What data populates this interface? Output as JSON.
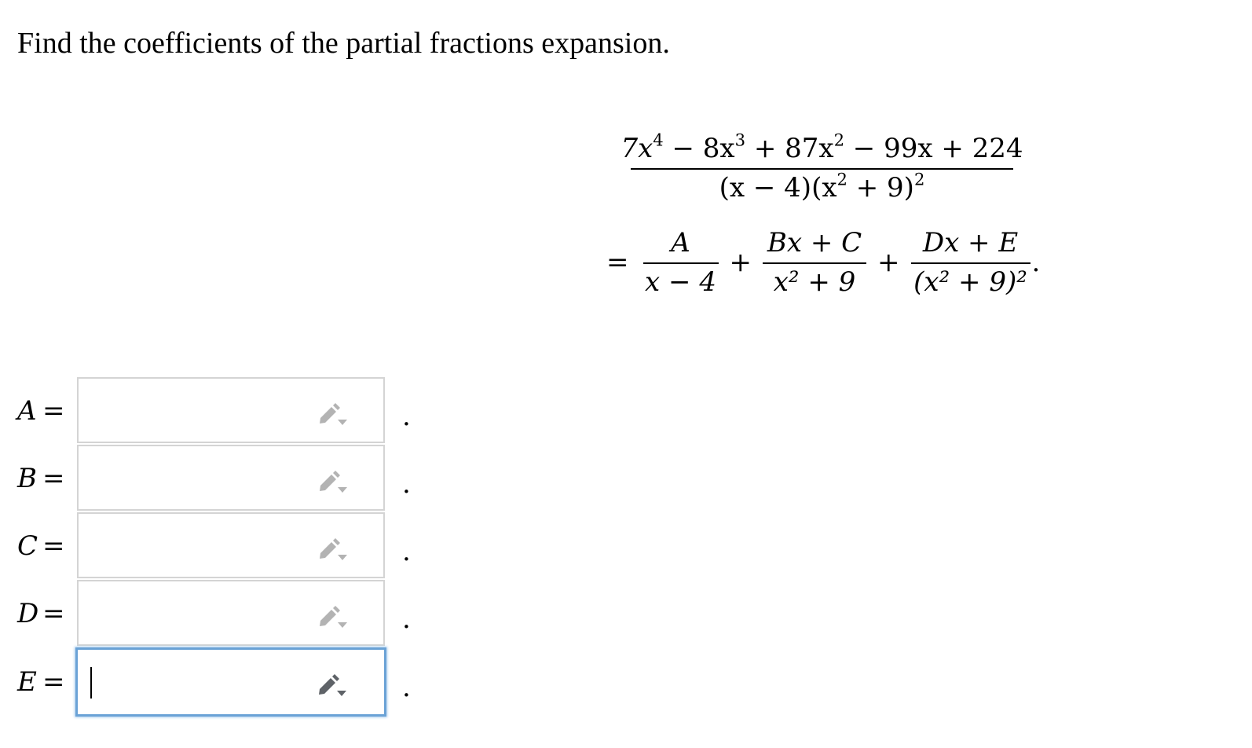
{
  "prompt": "Find the coefficients of the partial fractions expansion.",
  "equation": {
    "lhs_numerator": [
      "7x",
      "4",
      " − 8x",
      "3",
      " + 87x",
      "2",
      " − 99x + 224"
    ],
    "lhs_denominator": [
      "(x − 4)(x",
      "2",
      " + 9)",
      "2"
    ],
    "equals": "=",
    "terms": [
      {
        "numerator": "A",
        "denominator": "x − 4"
      },
      {
        "numerator": "Bx + C",
        "denominator": "x² + 9"
      },
      {
        "numerator": "Dx + E",
        "denominator": "(x² + 9)²"
      }
    ],
    "plus": "+",
    "end_punct": "."
  },
  "fields": [
    {
      "var": "A",
      "eq": "=",
      "value": "",
      "suffix": ".",
      "active": false
    },
    {
      "var": "B",
      "eq": "=",
      "value": "",
      "suffix": ".",
      "active": false
    },
    {
      "var": "C",
      "eq": "=",
      "value": "",
      "suffix": ".",
      "active": false
    },
    {
      "var": "D",
      "eq": "=",
      "value": "",
      "suffix": ".",
      "active": false
    },
    {
      "var": "E",
      "eq": "=",
      "value": "",
      "suffix": ".",
      "active": true
    }
  ],
  "icons": {
    "field_tool": "pencil-dropdown-icon"
  },
  "colors": {
    "field_border": "#d4d4d4",
    "field_active_border": "#6aa2d6",
    "pencil_inactive": "#b3b3b3",
    "pencil_active": "#5f6368"
  }
}
